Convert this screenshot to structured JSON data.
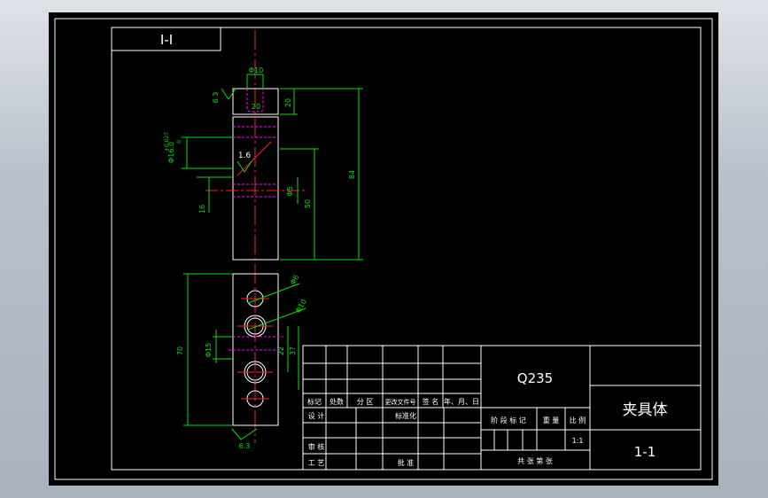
{
  "colors": {
    "background": "#000000",
    "border": "#ffffff",
    "centerline": "#ff2020",
    "dimension": "#00e000",
    "hidden": "#ff00ff",
    "text": "#ffffff"
  },
  "section_label": "I-I",
  "dimensions": {
    "top_dia": "Φ10",
    "surface_roughness_top": "6.3",
    "top_width": "20",
    "top_height": "20",
    "tolerance_dia": "Φ16.0",
    "tolerance_upper": "+0.027",
    "tolerance_lower": "0",
    "surface_roughness_mid": "1.6",
    "side_16": "16",
    "inner_dia": "Φ5",
    "inner_50": "50",
    "total_84": "84",
    "height_70": "70",
    "hole_6": "Φ6",
    "hole_10": "Φ10",
    "hole_15": "Φ15",
    "dim_22": "22",
    "dim_37": "37",
    "surface_roughness_bottom": "6.3"
  },
  "title_block": {
    "material": "Q235",
    "part_name": "夹具体",
    "drawing_no": "1-1",
    "scale": "1:1",
    "row_labels": [
      "标记",
      "处数",
      "分 区",
      "更改文件号",
      "签 名",
      "年、月、日"
    ],
    "design": "设 计",
    "standardization": "标准化",
    "stage_mark": "阶 段 标 记",
    "weight": "重 量",
    "ratio": "比 例",
    "review": "审 核",
    "process": "工 艺",
    "approve": "批 准",
    "sheets": "共      张  第      张"
  }
}
